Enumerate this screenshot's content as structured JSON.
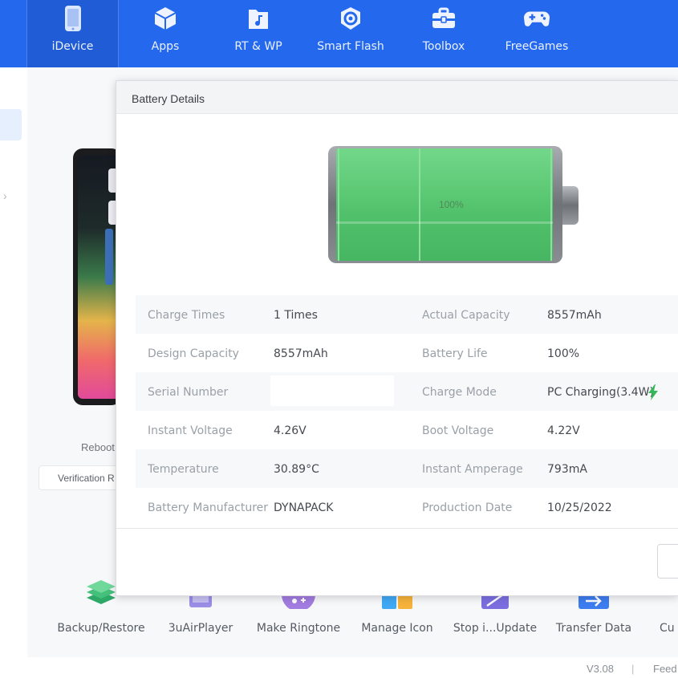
{
  "topbar": {
    "items": [
      {
        "label": "iDevice",
        "icon": "phone-icon",
        "active": true
      },
      {
        "label": "Apps",
        "icon": "cube-icon"
      },
      {
        "label": "RT & WP",
        "icon": "music-folder-icon"
      },
      {
        "label": "Smart Flash",
        "icon": "flash-gear-icon"
      },
      {
        "label": "Toolbox",
        "icon": "toolbox-icon"
      },
      {
        "label": "FreeGames",
        "icon": "gamepad-icon"
      }
    ],
    "colors": {
      "bar": "#2468ee",
      "active": "#1f5cd6"
    }
  },
  "device_panel": {
    "reboot_label": "Reboot",
    "verification_label": "Verification R"
  },
  "tools": [
    {
      "label": "Backup/Restore",
      "icon": "layers-icon"
    },
    {
      "label": "3uAirPlayer",
      "icon": "airplay-icon"
    },
    {
      "label": "Make Ringtone",
      "icon": "ringtone-icon"
    },
    {
      "label": "Manage Icon",
      "icon": "grid-icon"
    },
    {
      "label": "Stop i...Update",
      "icon": "stop-update-icon"
    },
    {
      "label": "Transfer Data",
      "icon": "transfer-icon"
    },
    {
      "label": "Cu",
      "icon": "none"
    }
  ],
  "footer": {
    "version": "V3.08",
    "separator": "|",
    "link": "Feed"
  },
  "dialog": {
    "title": "Battery Details",
    "battery": {
      "percent_label": "100%",
      "level": 1.0,
      "fill_color": "#5cc974"
    },
    "rows": [
      {
        "l1": "Charge Times",
        "v1": "1 Times",
        "l2": "Actual Capacity",
        "v2": "8557mAh"
      },
      {
        "l1": "Design Capacity",
        "v1": "8557mAh",
        "l2": "Battery Life",
        "v2": "100%"
      },
      {
        "l1": "Serial Number",
        "v1": "",
        "l2": "Charge Mode",
        "v2": "PC Charging(3.4W)"
      },
      {
        "l1": "Instant Voltage",
        "v1": "4.26V",
        "l2": "Boot Voltage",
        "v2": "4.22V"
      },
      {
        "l1": "Temperature",
        "v1": "30.89°C",
        "l2": "Instant Amperage",
        "v2": "793mA"
      },
      {
        "l1": "Battery Manufacturer",
        "v1": "DYNAPACK",
        "l2": "Production Date",
        "v2": "10/25/2022"
      }
    ],
    "charge_icon": "lightning-icon",
    "colors": {
      "label": "#9aa0a7",
      "value": "#45494f",
      "bolt": "#36b85a"
    }
  }
}
